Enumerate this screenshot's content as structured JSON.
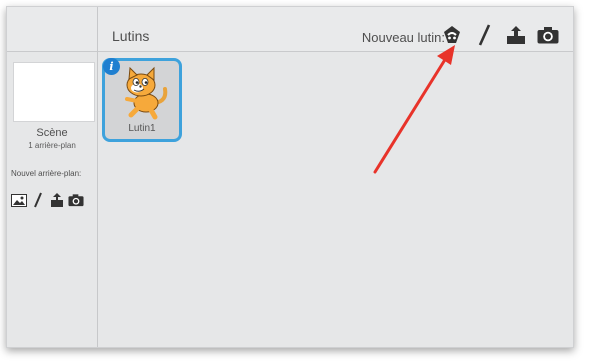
{
  "stage": {
    "title": "Scène",
    "subtitle": "1 arrière-plan",
    "new_backdrop_label": "Nouvel arrière-plan:"
  },
  "sprites": {
    "title": "Lutins",
    "new_sprite_label": "Nouveau lutin:",
    "tools": [
      "library-icon",
      "paint-brush-icon",
      "upload-icon",
      "camera-icon"
    ],
    "items": [
      {
        "name": "Lutin1",
        "selected": true
      }
    ]
  },
  "colors": {
    "selection": "#3ea2dc",
    "info_badge": "#1f7fd0",
    "annotation_arrow": "#e8332a"
  }
}
